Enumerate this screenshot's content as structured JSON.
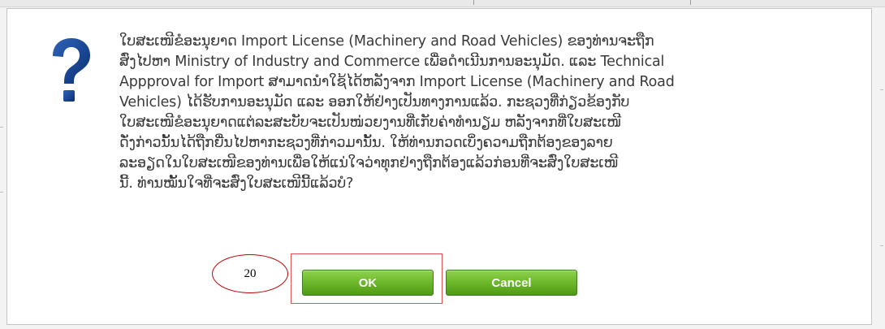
{
  "dialog": {
    "icon": "question-mark-icon",
    "message_lines": [
      "ໃບສະເໜີຂໍອະນຸຍາດ Import License (Machinery and Road Vehicles) ຂອງທ່ານຈະຖືກ",
      "ສົ່ງໄປຫາ Ministry of Industry and Commerce ເພື່ອດຳເນີນການອະນຸມັດ. ແລະ Technical",
      "Appproval for Import ສາມາດນໍາໃຊ້ໄດ້ຫລັງຈາກ Import License (Machinery and Road",
      "Vehicles) ໄດ້ຮັບການອະນຸມັດ ແລະ ອອກໃຫ້ຢ່າງເປັນທາງການແລ້ວ. ກະຊວງທີ່ກ່ຽວຂ້ອງກັບ",
      "ໃບສະເໜີຂໍອະນຸຍາດແຕ່ລະສະບັບຈະເປັນໜ່ວຍງານທີ່ເກັບຄ່າທໍານຽມ ຫລັງຈາກທີ່ໃບສະເໜີ",
      "ດັ່ງກ່າວນັ້ນໄດ້ຖືກຍື່ນໄປຫາກະຊວງທີ່ກ່າວມານັ້ນ. ໃຫ້ທ່ານກວດເບິ່ງຄວາມຖືກຕ້ອງຂອງລາຍ",
      "ລະອຽດໃນໃບສະເໜີຂອງທ່ານເພື່ອໃຫ້ແນ່ໃຈວ່າທຸກຢ່າງຖືກຕ້ອງແລ້ວກ່ອນທີ່ຈະສົ່ງໃບສະເໜີ",
      "ນີ້. ທ່ານໝັ້ນໃຈທີ່ຈະສົ່ງໃບສະເໜີນີ້ແລ້ວບໍ?"
    ],
    "ok_label": "OK",
    "cancel_label": "Cancel"
  },
  "annotation": {
    "step_number": "20",
    "color": "#c00000"
  },
  "colors": {
    "button_green": "#6fba2c",
    "icon_blue": "#0b3a86"
  }
}
